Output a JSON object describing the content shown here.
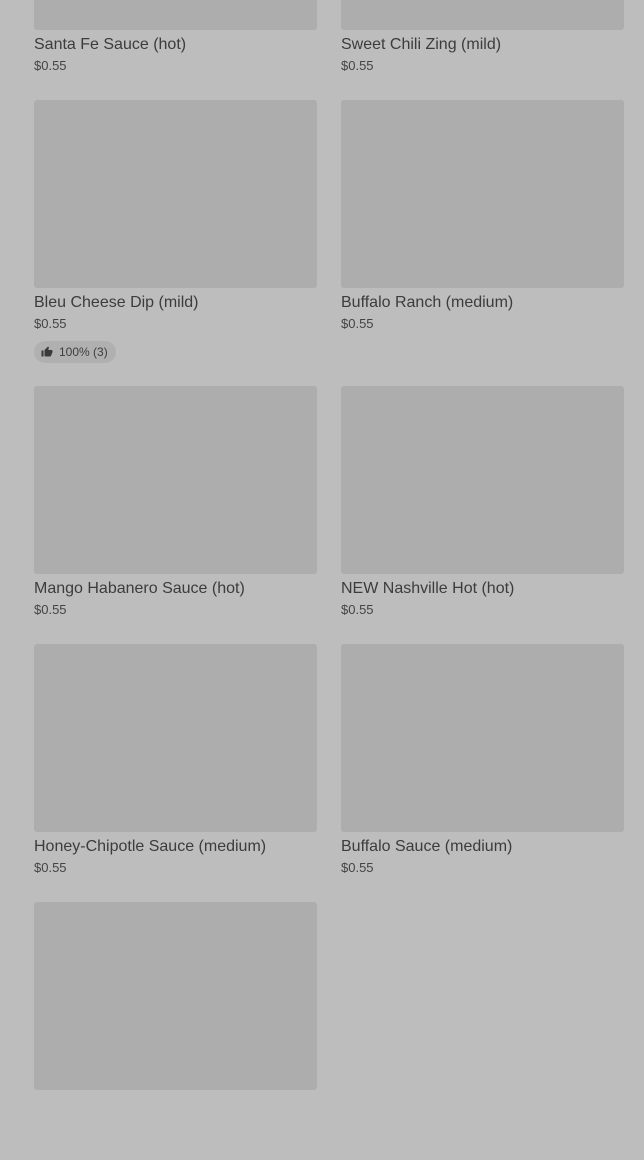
{
  "items": [
    {
      "name": "Santa Fe Sauce (hot)",
      "price": "$0.55"
    },
    {
      "name": "Sweet Chili Zing (mild)",
      "price": "$0.55"
    },
    {
      "name": "Bleu Cheese Dip (mild)",
      "price": "$0.55",
      "rating": "100% (3)"
    },
    {
      "name": "Buffalo Ranch (medium)",
      "price": "$0.55"
    },
    {
      "name": "Mango Habanero Sauce (hot)",
      "price": "$0.55"
    },
    {
      "name": "NEW Nashville Hot (hot)",
      "price": "$0.55"
    },
    {
      "name": "Honey-Chipotle Sauce (medium)",
      "price": "$0.55"
    },
    {
      "name": "Buffalo Sauce (medium)",
      "price": "$0.55"
    },
    {
      "name": "",
      "price": ""
    }
  ],
  "icons": {
    "rating": "thumbs-up-icon"
  }
}
